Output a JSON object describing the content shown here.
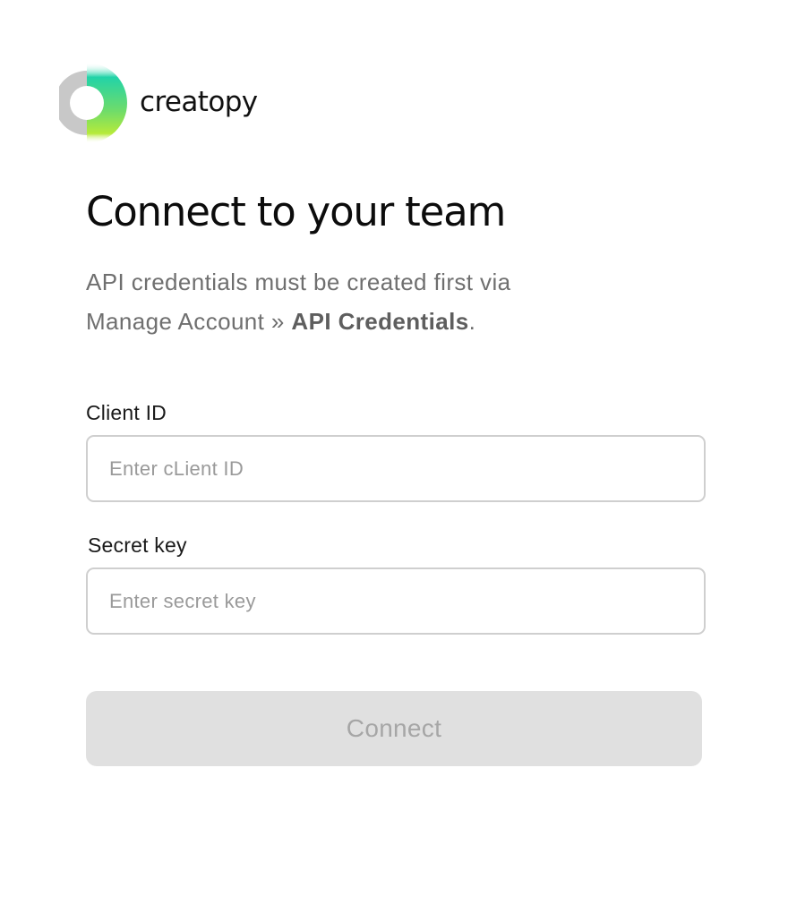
{
  "brand": {
    "name": "creatopy",
    "logo_icon": "creatopy-logo-icon",
    "colors": {
      "ring_gray": "#c8c8c8",
      "ring_teal": "#22d3a8",
      "ring_green": "#a8e63b"
    }
  },
  "header": {
    "title": "Connect to your team"
  },
  "intro": {
    "line1": "API credentials must be created first via",
    "line2_prefix": "Manage Account » ",
    "line2_link": "API Credentials",
    "line2_suffix": "."
  },
  "form": {
    "client_id": {
      "label": "Client ID",
      "placeholder": "Enter cLient ID",
      "value": ""
    },
    "secret_key": {
      "label": "Secret key",
      "placeholder": "Enter secret key",
      "value": ""
    },
    "connect_label": "Connect"
  }
}
